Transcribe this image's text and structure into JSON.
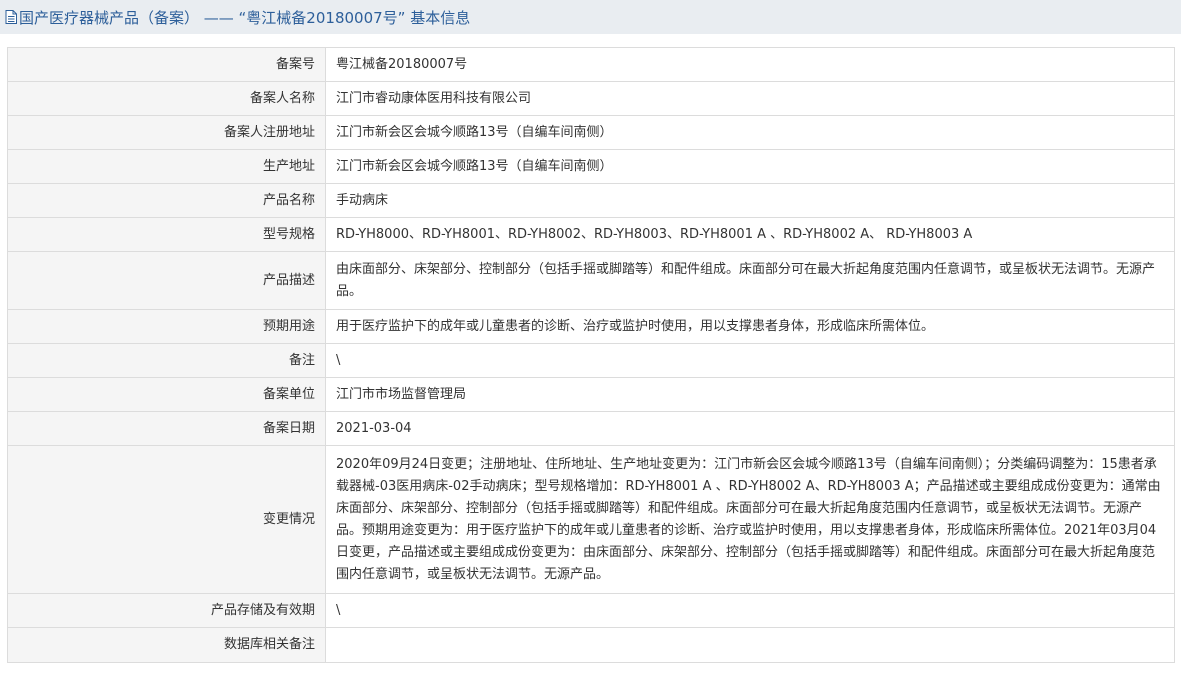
{
  "header": {
    "icon": "document-icon",
    "title": "国产医疗器械产品（备案） —— “粤江械备20180007号” 基本信息"
  },
  "rows": [
    {
      "label": "备案号",
      "value": "粤江械备20180007号"
    },
    {
      "label": "备案人名称",
      "value": "江门市睿动康体医用科技有限公司"
    },
    {
      "label": "备案人注册地址",
      "value": "江门市新会区会城今顺路13号（自编车间南侧）"
    },
    {
      "label": "生产地址",
      "value": "江门市新会区会城今顺路13号（自编车间南侧）"
    },
    {
      "label": "产品名称",
      "value": "手动病床"
    },
    {
      "label": "型号规格",
      "value": "RD-YH8000、RD-YH8001、RD-YH8002、RD-YH8003、RD-YH8001 A 、RD-YH8002 A、 RD-YH8003 A"
    },
    {
      "label": "产品描述",
      "value": "由床面部分、床架部分、控制部分（包括手摇或脚踏等）和配件组成。床面部分可在最大折起角度范围内任意调节，或呈板状无法调节。无源产品。"
    },
    {
      "label": "预期用途",
      "value": "用于医疗监护下的成年或儿童患者的诊断、治疗或监护时使用，用以支撑患者身体，形成临床所需体位。"
    },
    {
      "label": "备注",
      "value": "\\"
    },
    {
      "label": "备案单位",
      "value": "江门市市场监督管理局"
    },
    {
      "label": "备案日期",
      "value": "2021-03-04"
    },
    {
      "label": "变更情况",
      "value": "2020年09月24日变更；注册地址、住所地址、生产地址变更为：江门市新会区会城今顺路13号（自编车间南侧）；分类编码调整为：15患者承载器械-03医用病床-02手动病床；型号规格增加：RD-YH8001 A 、RD-YH8002 A、RD-YH8003 A；产品描述或主要组成成份变更为：通常由床面部分、床架部分、控制部分（包括手摇或脚踏等）和配件组成。床面部分可在最大折起角度范围内任意调节，或呈板状无法调节。无源产品。预期用途变更为：用于医疗监护下的成年或儿童患者的诊断、治疗或监护时使用，用以支撑患者身体，形成临床所需体位。2021年03月04日变更，产品描述或主要组成成份变更为：由床面部分、床架部分、控制部分（包括手摇或脚踏等）和配件组成。床面部分可在最大折起角度范围内任意调节，或呈板状无法调节。无源产品。"
    },
    {
      "label": "产品存储及有效期",
      "value": "\\"
    },
    {
      "label": "数据库相关备注",
      "value": ""
    }
  ]
}
